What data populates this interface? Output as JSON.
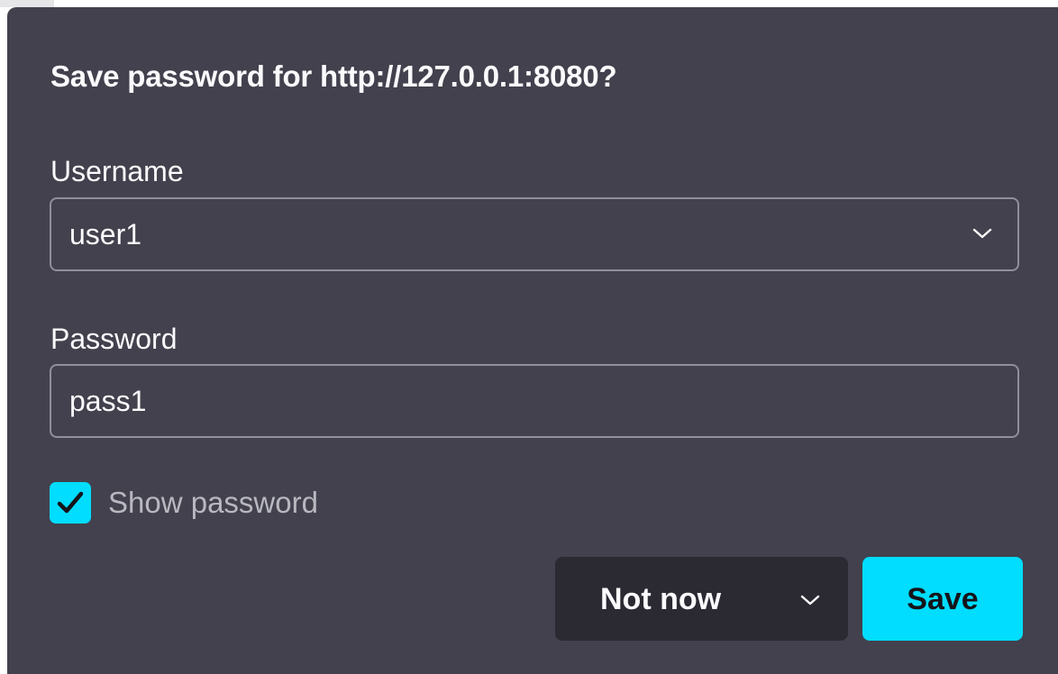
{
  "dialog": {
    "title": "Save password for http://127.0.0.1:8080?"
  },
  "username": {
    "label": "Username",
    "value": "user1",
    "dropdown_icon": "chevron-down-icon"
  },
  "password": {
    "label": "Password",
    "value": "pass1"
  },
  "show_password": {
    "label": "Show password",
    "checked": true,
    "icon": "checkmark-icon"
  },
  "actions": {
    "not_now_label": "Not now",
    "not_now_icon": "chevron-down-icon",
    "save_label": "Save"
  },
  "colors": {
    "panel_background": "#42414d",
    "accent": "#00ddff",
    "secondary_button": "#2b2a33",
    "field_border": "#8f8f9d",
    "text": "#fbfbfe"
  }
}
